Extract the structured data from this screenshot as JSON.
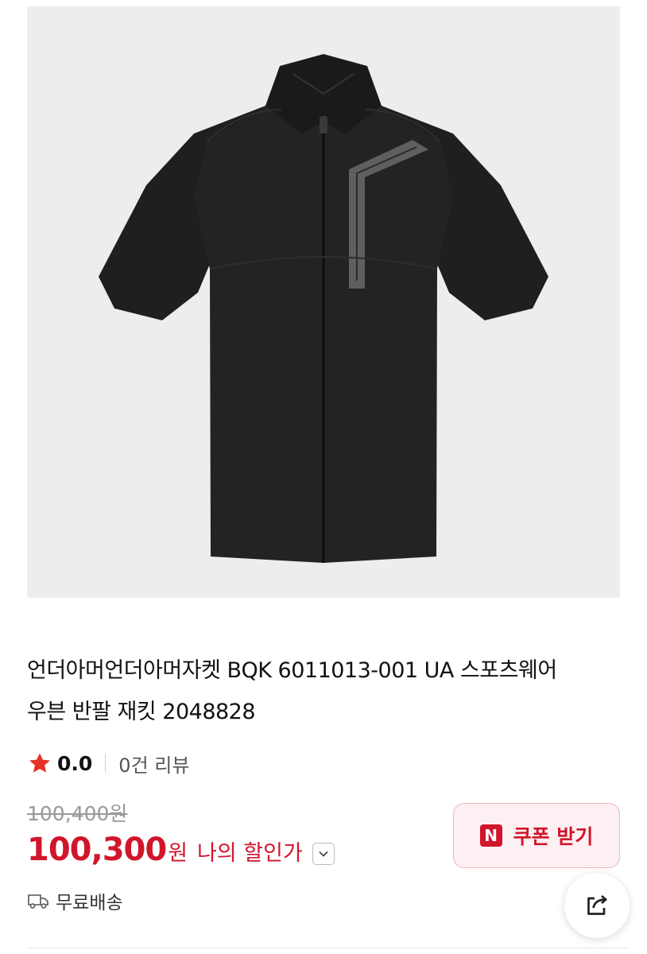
{
  "product": {
    "image_alt": "black short-sleeve zip jacket",
    "title": "언더아머언더아머자켓 BQK 6011013-001 UA 스포츠웨어 우븐 반팔 재킷 2048828"
  },
  "rating": {
    "value": "0.0",
    "review_count": "0건 리뷰",
    "star_color": "#e53225"
  },
  "price": {
    "original": "100,400원",
    "sale": "100,300",
    "currency": "원",
    "my_discount_label": "나의 할인가"
  },
  "coupon": {
    "badge": "N",
    "label": "쿠폰 받기"
  },
  "shipping": {
    "label": "무료배송"
  },
  "icons": {
    "star": "star-icon",
    "chevron": "chevron-down-icon",
    "truck": "truck-icon",
    "share": "share-icon"
  },
  "colors": {
    "accent": "#d1152b",
    "coupon_bg": "#fdf0f2",
    "image_bg": "#ededed"
  }
}
